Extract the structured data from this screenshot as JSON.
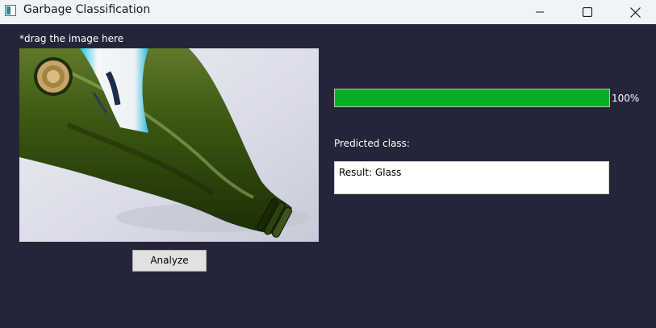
{
  "window": {
    "title": "Garbage Classification",
    "icon": "app-icon",
    "controls": {
      "minimize_icon": "minimize-icon",
      "maximize_icon": "maximize-icon",
      "close_icon": "close-icon"
    }
  },
  "main": {
    "drag_hint": "*drag the image here",
    "image_content": "green-glass-bottle-photo",
    "analyze_label": "Analyze",
    "progress": {
      "value_percent": 100,
      "text": "100%",
      "fill_color": "#06b025"
    },
    "predicted_label": "Predicted class:",
    "result_text": "Result: Glass"
  },
  "colors": {
    "background": "#25253a",
    "titlebar": "#eff4f9",
    "text": "#ffffff"
  }
}
